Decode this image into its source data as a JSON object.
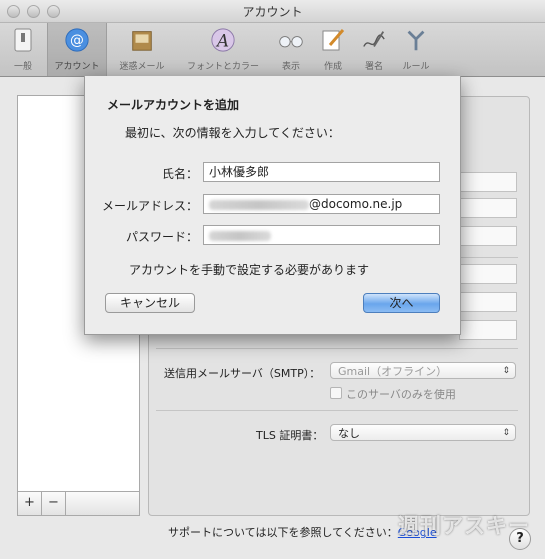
{
  "window": {
    "title": "アカウント"
  },
  "toolbar": {
    "items": [
      {
        "label": "一般",
        "icon": "switch-icon"
      },
      {
        "label": "アカウント",
        "icon": "at-sign-icon",
        "selected": true
      },
      {
        "label": "迷惑メール",
        "icon": "junk-mail-icon"
      },
      {
        "label": "フォントとカラー",
        "icon": "font-icon"
      },
      {
        "label": "表示",
        "icon": "glasses-icon"
      },
      {
        "label": "作成",
        "icon": "compose-icon"
      },
      {
        "label": "署名",
        "icon": "signature-icon"
      },
      {
        "label": "ルール",
        "icon": "rules-icon"
      }
    ]
  },
  "sheet": {
    "title": "メールアカウントを追加",
    "subtitle": "最初に、次の情報を入力してください：",
    "name_label": "氏名：",
    "name_value": "小林優多郎",
    "email_label": "メールアドレス：",
    "email_value_visible": "@docomo.ne.jp",
    "password_label": "パスワード：",
    "note": "アカウントを手動で設定する必要があります",
    "cancel_label": "キャンセル",
    "next_label": "次へ"
  },
  "detail": {
    "smtp_label": "送信用メールサーバ（SMTP）：",
    "smtp_value": "Gmail（オフライン）",
    "smtp_only_label": "このサーバのみを使用",
    "tls_label": "TLS 証明書：",
    "tls_value": "なし"
  },
  "list_controls": {
    "add": "+",
    "remove": "−"
  },
  "footer": {
    "text": "サポートについては以下を参照してください：",
    "link": "Google",
    "help": "?"
  },
  "watermark": "週刊アスキー"
}
